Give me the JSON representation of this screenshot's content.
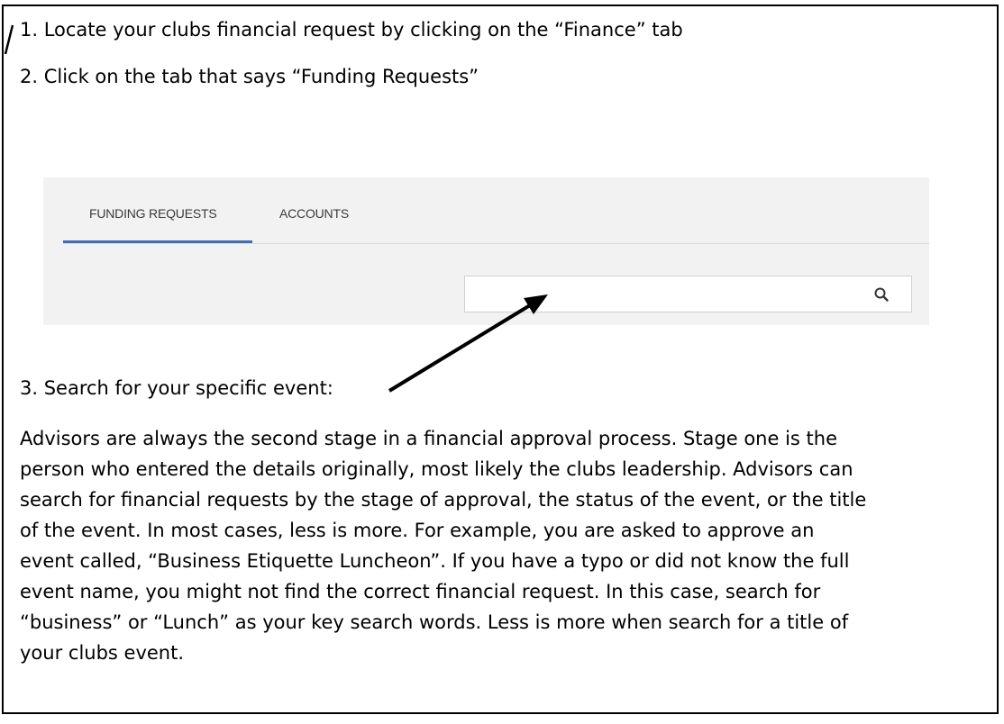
{
  "steps": {
    "step1": "1. Locate your clubs financial request by clicking on the “Finance” tab",
    "step2": "2. Click on the tab that says “Funding Requests”",
    "step3": "3. Search for your specific event:"
  },
  "screenshot": {
    "tabs": [
      {
        "label": "FUNDING REQUESTS",
        "active": true
      },
      {
        "label": "ACCOUNTS",
        "active": false
      }
    ],
    "search": {
      "value": "",
      "placeholder": "",
      "icon": "search-icon"
    },
    "accent_color": "#3f6fb5"
  },
  "paragraph_lines": [
    "Advisors are always the second stage in a financial approval process.  Stage one is the",
    "person who entered the details originally, most likely the clubs leadership.  Advisors can",
    "search for financial requests by the stage of approval, the status of the event, or the title",
    "of the event.  In most cases, less is more.  For example, you are asked to approve an",
    "event called, “Business Etiquette Luncheon”.  If you have a typo or did not know the full",
    "event name, you might not find the correct financial request.  In this case, search for",
    "“business” or “Lunch” as your key search words.  Less is more when search for a title of",
    "your clubs event."
  ]
}
